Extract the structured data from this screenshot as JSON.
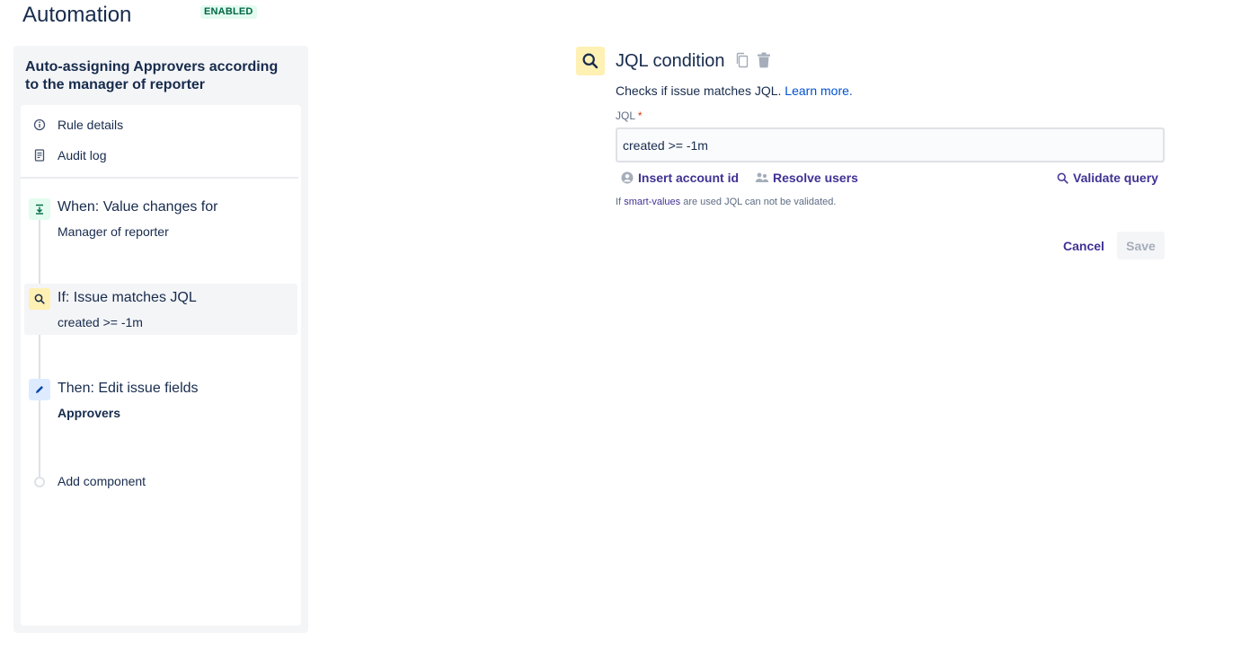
{
  "header": {
    "title": "Automation",
    "status_lozenge": "ENABLED"
  },
  "sidebar": {
    "rule_title": "Auto-assigning Approvers according to the manager of reporter",
    "nav": [
      {
        "label": "Rule details",
        "icon": "info-icon"
      },
      {
        "label": "Audit log",
        "icon": "document-icon"
      }
    ],
    "steps": [
      {
        "title": "When: Value changes for",
        "subtitle": "Manager of reporter",
        "icon": "trigger-icon",
        "color": "#e3fcef"
      },
      {
        "title": "If: Issue matches JQL",
        "subtitle": "created >= -1m",
        "icon": "search-icon",
        "color": "#fff0b3",
        "active": true
      },
      {
        "title": "Then: Edit issue fields",
        "subtitle": "Approvers",
        "icon": "pencil-icon",
        "color": "#deebff"
      }
    ],
    "add_component_label": "Add component"
  },
  "main": {
    "title": "JQL condition",
    "description": "Checks if issue matches JQL.",
    "learn_more": "Learn more.",
    "field_label": "JQL",
    "required_marker": "*",
    "jql_value": "created >= -1m",
    "actions": {
      "insert_account_id": "Insert account id",
      "resolve_users": "Resolve users",
      "validate_query": "Validate query"
    },
    "help": {
      "prefix": "If",
      "link": "smart-values",
      "suffix": "are used JQL can not be validated."
    },
    "buttons": {
      "cancel": "Cancel",
      "save": "Save"
    }
  },
  "colors": {
    "primary_text": "#172b4d",
    "link_purple": "#403294",
    "link_blue": "#0052cc",
    "enabled_bg": "#e3fcef",
    "enabled_text": "#006644",
    "jql_badge": "#fff0b3"
  }
}
